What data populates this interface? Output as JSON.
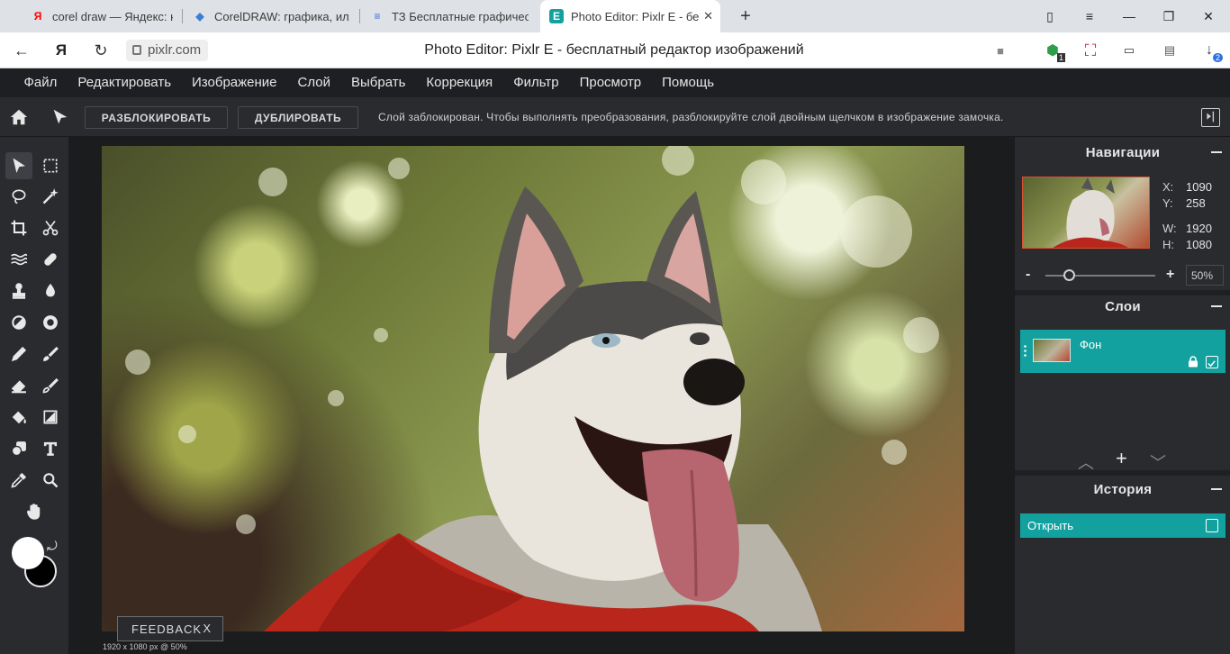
{
  "browser": {
    "tabs": [
      {
        "label": "corel draw — Яндекс: наш",
        "favicon": "Я",
        "favicon_color": "#ff0000"
      },
      {
        "label": "CorelDRAW: графика, илл",
        "favicon": "◆",
        "favicon_color": "#3b7dd8"
      },
      {
        "label": "ТЗ Бесплатные графическ",
        "favicon": "≡",
        "favicon_color": "#2f6fe0"
      },
      {
        "label": "Photo Editor: Pixlr E - бе",
        "favicon": "E",
        "favicon_color": "#13a1a0",
        "active": true
      }
    ],
    "new_tab": "+",
    "url": "pixlr.com",
    "page_title": "Photo Editor: Pixlr E - бесплатный редактор изображений",
    "ext_badge_1": "1",
    "ext_badge_2": "2"
  },
  "menubar": {
    "items": [
      "Файл",
      "Редактировать",
      "Изображение",
      "Слой",
      "Выбрать",
      "Коррекция",
      "Фильтр",
      "Просмотр",
      "Помощь"
    ]
  },
  "options": {
    "unlock_label": "РАЗБЛОКИРОВАТЬ",
    "duplicate_label": "ДУБЛИРОВАТЬ",
    "message": "Слой заблокирован. Чтобы выполнять преобразования, разблокируйте слой двойным щелчком в изображение замочка."
  },
  "canvas": {
    "feedback_label": "FEEDBACK",
    "feedback_close": "X",
    "status": "1920 x 1080 px @ 50%"
  },
  "navigator": {
    "title": "Навигации",
    "x_label": "X:",
    "x_value": "1090",
    "y_label": "Y:",
    "y_value": "258",
    "w_label": "W:",
    "w_value": "1920",
    "h_label": "H:",
    "h_value": "1080",
    "zoom_minus": "-",
    "zoom_plus": "+",
    "zoom_value": "50%"
  },
  "layers": {
    "title": "Слои",
    "items": [
      {
        "name": "Фон"
      }
    ]
  },
  "history": {
    "title": "История",
    "items": [
      {
        "label": "Открыть"
      }
    ]
  },
  "colors": {
    "accent": "#13a1a0",
    "foreground": "#ffffff",
    "background": "#000000"
  }
}
